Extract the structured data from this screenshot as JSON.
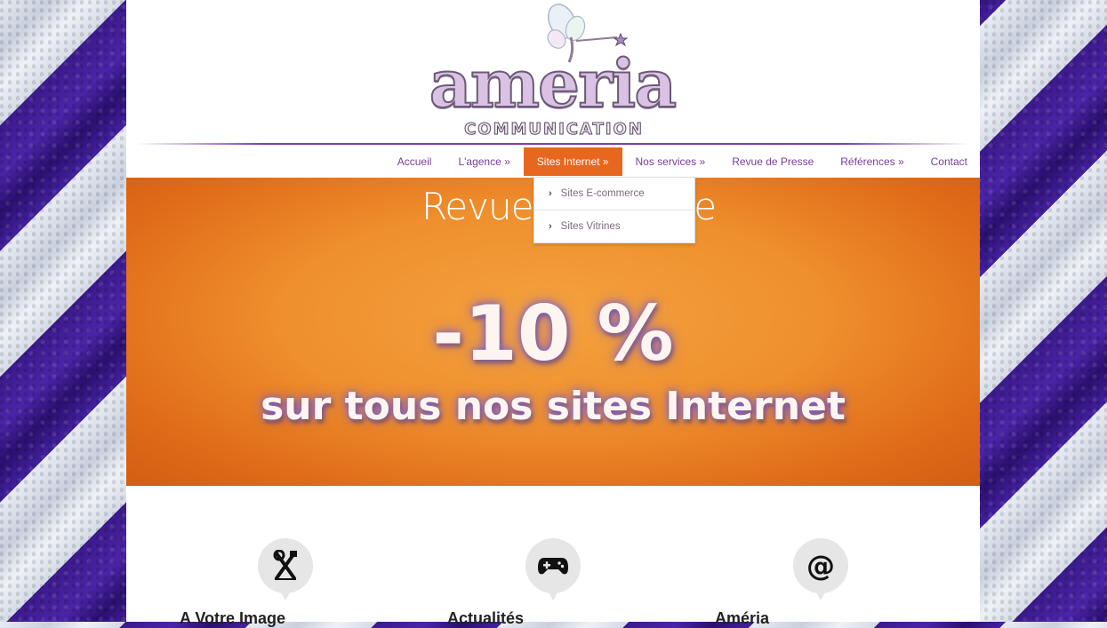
{
  "header": {
    "logo_word": "ameria",
    "logo_sub": "COMMUNICATION"
  },
  "nav": {
    "items": [
      {
        "label": "Accueil"
      },
      {
        "label": "L'agence »"
      },
      {
        "label": "Sites Internet »"
      },
      {
        "label": "Nos services »"
      },
      {
        "label": "Revue de Presse"
      },
      {
        "label": "Références »"
      },
      {
        "label": "Contact"
      }
    ],
    "active_index": 2
  },
  "dropdown": {
    "items": [
      {
        "label": "Sites E-commerce"
      },
      {
        "label": "Sites Vitrines"
      }
    ]
  },
  "banner": {
    "title": "Revue de Presse",
    "big": "-10 %",
    "sub": "sur tous nos sites Internet"
  },
  "features": [
    {
      "title": "A Votre Image",
      "icon": "tools-icon"
    },
    {
      "title": "Actualités",
      "icon": "gamepad-icon"
    },
    {
      "title": "Améria",
      "icon": "at-sign-icon"
    }
  ],
  "colors": {
    "accent": "#e8671e",
    "nav_text": "#7a3c9a",
    "nav_line": "#7a3fb0",
    "banner": "#ef8f2d"
  }
}
